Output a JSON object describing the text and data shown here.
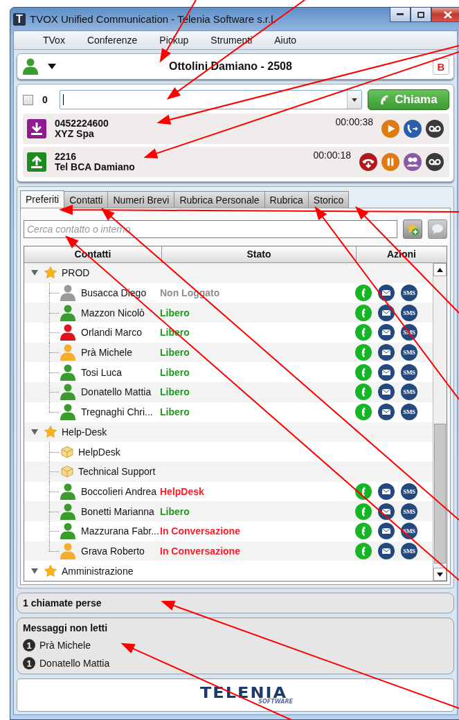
{
  "window": {
    "icon_letter": "T",
    "title": "TVOX Unified Communication - Telenia Software s.r.l."
  },
  "menu": [
    "TVox",
    "Conferenze",
    "Pickup",
    "Strumenti",
    "Aiuto"
  ],
  "user": {
    "name": "Ottolini Damiano - 2508",
    "badge": "B"
  },
  "dialer": {
    "checked": false,
    "count": "0",
    "button": "Chiama"
  },
  "calls": [
    {
      "kind": "incoming",
      "number": "0452224600",
      "name": "XYZ Spa",
      "duration": "00:00:38",
      "actions": [
        {
          "kind": "play"
        },
        {
          "kind": "transfer"
        },
        {
          "kind": "voicemail"
        }
      ]
    },
    {
      "kind": "outgoing",
      "number": "2216",
      "name": "Tel BCA Damiano",
      "duration": "00:00:18",
      "actions": [
        {
          "kind": "hangup"
        },
        {
          "kind": "pause"
        },
        {
          "kind": "conference"
        },
        {
          "kind": "voicemail"
        }
      ]
    }
  ],
  "tabs": [
    {
      "label": "Preferiti",
      "selected": true
    },
    {
      "label": "Contatti",
      "selected": false
    },
    {
      "label": "Numeri Brevi",
      "selected": false
    },
    {
      "label": "Rubrica Personale",
      "selected": false
    },
    {
      "label": "Rubrica",
      "selected": false
    },
    {
      "label": "Storico",
      "selected": false
    }
  ],
  "search": {
    "placeholder": "Cerca contatto o interno"
  },
  "table": {
    "columns": [
      "Contatti",
      "Stato",
      "Azioni"
    ],
    "groups": [
      {
        "name": "PROD",
        "expanded": true,
        "children": [
          {
            "kind": "person",
            "name": "Busacca Diego",
            "color": "#9a9a9a",
            "status": {
              "text": "Non Loggato",
              "color": "#8c8c8c"
            },
            "sms": "SMS"
          },
          {
            "kind": "person",
            "name": "Mazzon Nicolò",
            "color": "#3a9c2c",
            "status": {
              "text": "Libero",
              "color": "#1f9a1f"
            },
            "sms": "SMS"
          },
          {
            "kind": "person",
            "name": "Orlandi Marco",
            "color": "#e0141e",
            "status": {
              "text": "Libero",
              "color": "#1f9a1f"
            },
            "sms": "SMS"
          },
          {
            "kind": "person",
            "name": "Prà Michele",
            "color": "#f5ad2b",
            "status": {
              "text": "Libero",
              "color": "#1f9a1f"
            },
            "sms": "SMS"
          },
          {
            "kind": "person",
            "name": "Tosi Luca",
            "color": "#3a9c2c",
            "status": {
              "text": "Libero",
              "color": "#1f9a1f"
            },
            "sms": "SMS"
          },
          {
            "kind": "person",
            "name": "Donatello Mattia",
            "color": "#3a9c2c",
            "status": {
              "text": "Libero",
              "color": "#1f9a1f"
            },
            "sms": "SMS"
          },
          {
            "kind": "person",
            "name": "Tregnaghi Chri...",
            "color": "#3a9c2c",
            "status": {
              "text": "Libero",
              "color": "#1f9a1f"
            },
            "sms": "SMS"
          }
        ]
      },
      {
        "name": "Help-Desk",
        "expanded": true,
        "children": [
          {
            "kind": "queue",
            "name": "HelpDesk"
          },
          {
            "kind": "queue",
            "name": "Technical Support"
          },
          {
            "kind": "person",
            "name": "Boccolieri Andrea",
            "color": "#3a9c2c",
            "status": {
              "text": "HelpDesk",
              "color": "#ff1a2a"
            },
            "sms": "SMS"
          },
          {
            "kind": "person",
            "name": "Bonetti Marianna",
            "color": "#3a9c2c",
            "status": {
              "text": "Libero",
              "color": "#1f9a1f"
            },
            "sms": "SMS"
          },
          {
            "kind": "person",
            "name": "Mazzurana Fabr...",
            "color": "#3a9c2c",
            "status": {
              "text": "In Conversazione",
              "color": "#ff1a2a"
            },
            "sms": "SMS"
          },
          {
            "kind": "person",
            "name": "Grava Roberto",
            "color": "#f5ad2b",
            "status": {
              "text": "In Conversazione",
              "color": "#ff1a2a"
            },
            "sms": "SMS"
          }
        ]
      },
      {
        "name": "Amministrazione",
        "expanded": true
      }
    ]
  },
  "missed_calls": "1 chiamate perse",
  "unread": {
    "title": "Messaggi non letti",
    "items": [
      {
        "count": "1",
        "name": "Prà Michele"
      },
      {
        "count": "1",
        "name": "Donatello Mattia"
      }
    ]
  },
  "logo": {
    "name": "TELENIA",
    "sub": "SOFTWARE"
  }
}
